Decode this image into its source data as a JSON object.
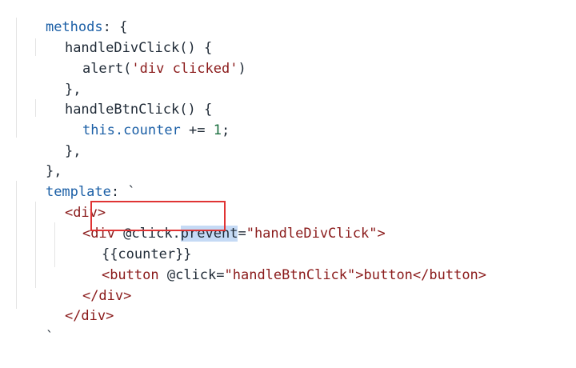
{
  "code": {
    "line1_key": "methods",
    "line1_punct": ": {",
    "line2_fn": "handleDivClick",
    "line2_punct": "() {",
    "line3_call": "alert",
    "line3_open": "(",
    "line3_str": "'div clicked'",
    "line3_close": ")",
    "line4": "},",
    "line5_fn": "handleBtnClick",
    "line5_punct": "() {",
    "line6_this": "this",
    "line6_prop": ".counter",
    "line6_op": " += ",
    "line6_num": "1",
    "line6_semi": ";",
    "line7": "},",
    "line8": "},",
    "line9_key": "template",
    "line9_punct": ": `",
    "line10_tag": "<div>",
    "line11_tag_open": "<div",
    "line11_attr_a": " @click.",
    "line11_attr_hl": "prevent",
    "line11_eq": "=",
    "line11_val": "\"handleDivClick\"",
    "line11_tag_close": ">",
    "line12_text": "{{counter}}",
    "line13_tag_open": "<button",
    "line13_attr": " @click=",
    "line13_val": "\"handleBtnClick\"",
    "line13_mid": ">button</button>",
    "line14_tag": "</div>",
    "line15_tag": "</div>",
    "line16": "`"
  },
  "colors": {
    "keyword": "#1b5fa6",
    "string": "#8a1a1a",
    "number": "#1b6f3f",
    "highlight": "#c5daf5",
    "annotation_box": "#e03434"
  }
}
